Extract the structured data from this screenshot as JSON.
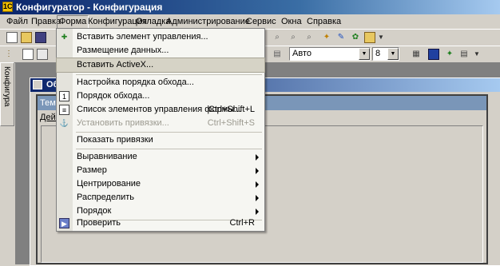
{
  "window": {
    "title": "Конфигуратор - Конфигурация"
  },
  "menubar": {
    "items": [
      "Файл",
      "Правка",
      "Форма",
      "Конфигурация",
      "Отладка",
      "Администрирование",
      "Сервис",
      "Окна",
      "Справка"
    ]
  },
  "toolbar": {
    "font_combo_value": "Авто",
    "size_combo_value": "8"
  },
  "side_panel": {
    "label": "Конфигура"
  },
  "object_window": {
    "title": "Об"
  },
  "form_window": {
    "title": "Тема",
    "menu_label": "Дейс"
  },
  "dropdown": {
    "items": [
      {
        "label": "Вставить элемент управления...",
        "shortcut": "",
        "state": "normal",
        "icon": "insert-control-icon"
      },
      {
        "label": "Размещение данных...",
        "shortcut": "",
        "state": "normal",
        "icon": ""
      },
      {
        "label": "Вставить ActiveX...",
        "shortcut": "",
        "state": "highlighted",
        "icon": ""
      },
      {
        "label": "Настройка порядка обхода...",
        "shortcut": "",
        "state": "normal",
        "icon": ""
      },
      {
        "label": "Порядок обхода...",
        "shortcut": "",
        "state": "normal",
        "icon": "tab-order-icon"
      },
      {
        "label": "Список элементов управления формы...",
        "shortcut": "Ctrl+Shift+L",
        "state": "normal",
        "icon": "control-list-icon"
      },
      {
        "label": "Установить привязки...",
        "shortcut": "Ctrl+Shift+S",
        "state": "disabled",
        "icon": "bindings-icon"
      },
      {
        "label": "Показать привязки",
        "shortcut": "",
        "state": "normal",
        "icon": ""
      },
      {
        "label": "Выравнивание",
        "shortcut": "",
        "state": "submenu",
        "icon": ""
      },
      {
        "label": "Размер",
        "shortcut": "",
        "state": "submenu",
        "icon": ""
      },
      {
        "label": "Центрирование",
        "shortcut": "",
        "state": "submenu",
        "icon": ""
      },
      {
        "label": "Распределить",
        "shortcut": "",
        "state": "submenu",
        "icon": ""
      },
      {
        "label": "Порядок",
        "shortcut": "",
        "state": "submenu",
        "icon": ""
      },
      {
        "label": "Проверить",
        "shortcut": "Ctrl+R",
        "state": "normal",
        "icon": "check-icon"
      }
    ]
  },
  "colors": {
    "titlebar": "#0a246a",
    "menu_bg": "#f6f6f2",
    "highlight": "#d6d3c6",
    "disabled_text": "#9c9a90"
  }
}
